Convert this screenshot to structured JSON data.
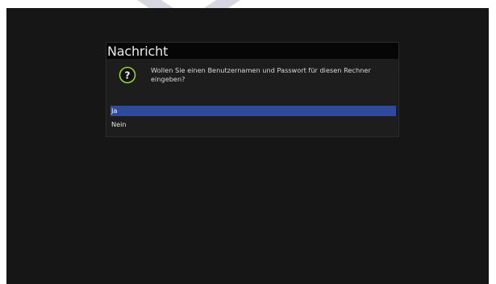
{
  "dialog": {
    "title": "Nachricht",
    "icon": "question-icon",
    "message": "Wollen Sie einen Benutzernamen und Passwort für diesen Rechner eingeben?",
    "options": [
      {
        "label": "Ja",
        "selected": true
      },
      {
        "label": "Nein",
        "selected": false
      }
    ]
  },
  "colors": {
    "background": "#161616",
    "dialog_background": "#1d1d1d",
    "header_background": "#060606",
    "selection": "#2f4a9a",
    "icon_ring": "#9bd32d"
  }
}
